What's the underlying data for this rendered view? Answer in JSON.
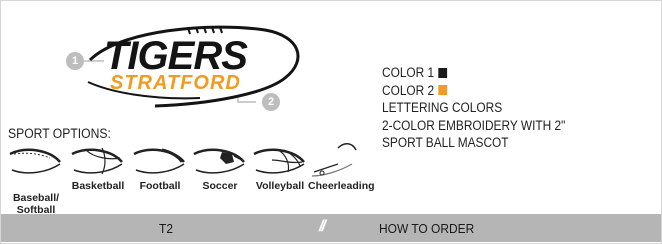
{
  "logo": {
    "title": "TIGERS",
    "subtitle": "STRATFORD",
    "badge_1": "1",
    "badge_2": "2",
    "colors": {
      "title": "#141414",
      "subtitle": "#f39a1f",
      "badge": "#bdbdbd"
    }
  },
  "options": {
    "color1_label": "COLOR 1",
    "color1_swatch": "#1a1a1a",
    "color2_label": "COLOR 2",
    "color2_swatch": "#f39a1f",
    "lettering": "LETTERING COLORS",
    "embroidery": "2-COLOR EMBROIDERY WITH 2\"",
    "mascot": "SPORT BALL MASCOT"
  },
  "sports": {
    "heading": "SPORT OPTIONS:",
    "items": [
      {
        "label": "Baseball/\nSoftball",
        "icon": "baseball-icon"
      },
      {
        "label": "Basketball",
        "icon": "basketball-icon"
      },
      {
        "label": "Football",
        "icon": "football-icon"
      },
      {
        "label": "Soccer",
        "icon": "soccer-icon"
      },
      {
        "label": "Volleyball",
        "icon": "volleyball-icon"
      },
      {
        "label": "Cheerleading",
        "icon": "cheerleading-icon"
      }
    ]
  },
  "footer": {
    "code": "T2",
    "separator": "//",
    "how_to": "HOW TO ORDER",
    "background": "#b5b5b5"
  }
}
